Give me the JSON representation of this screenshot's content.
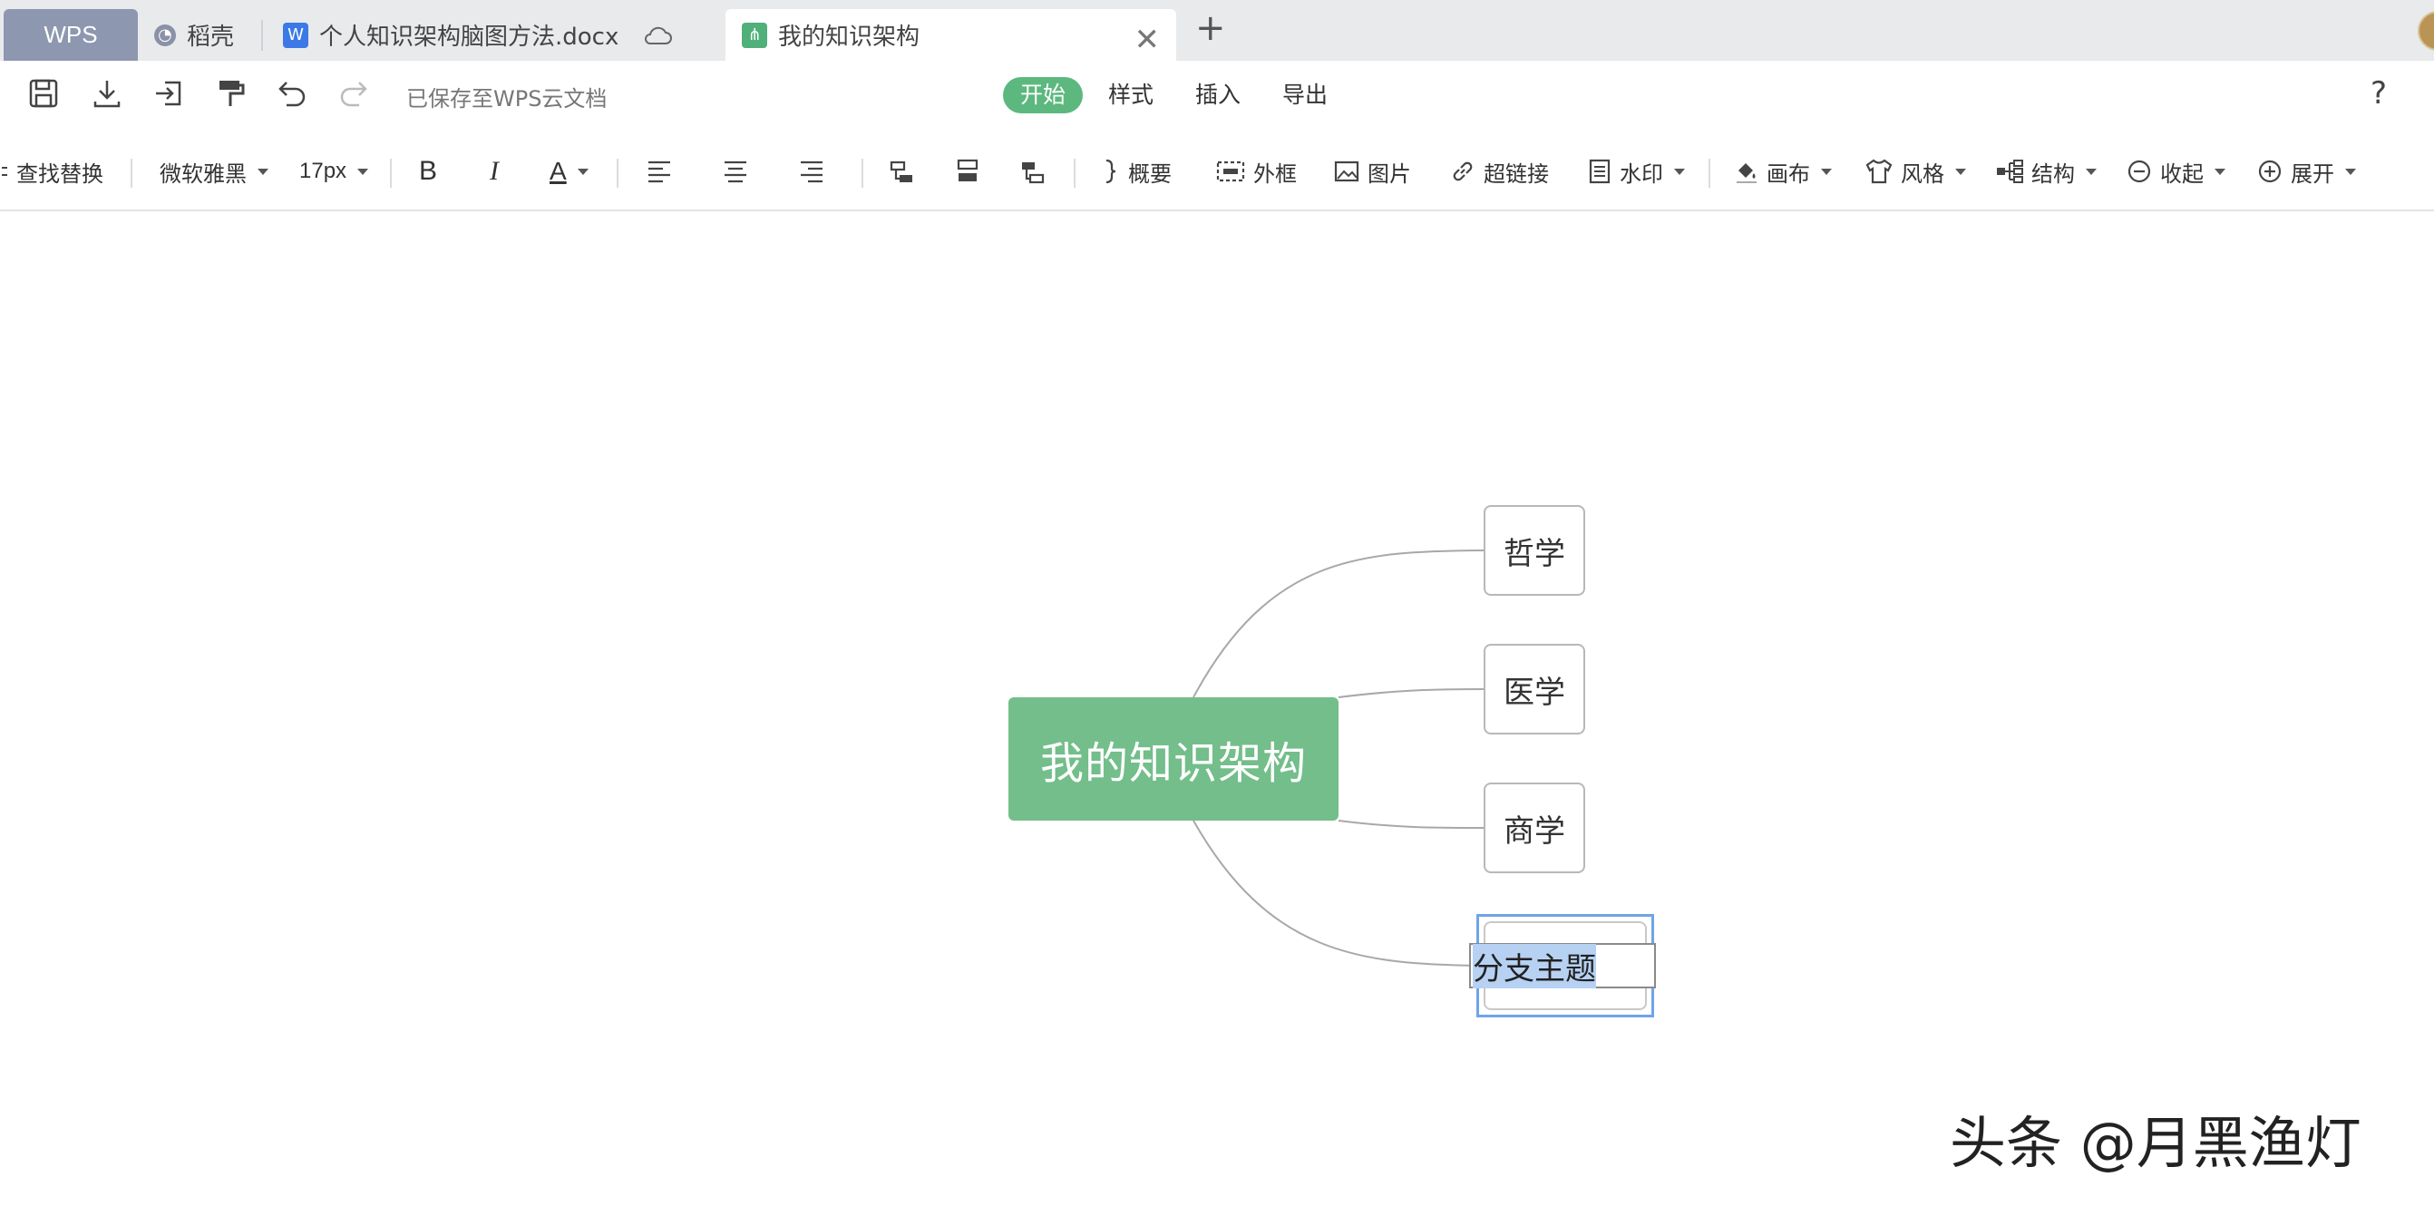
{
  "tabs": [
    {
      "label": "WPS"
    },
    {
      "label": "稻壳"
    },
    {
      "label": "个人知识架构脑图方法.docx"
    },
    {
      "label": "我的知识架构"
    }
  ],
  "toolbar1": {
    "saved_status": "已保存至WPS云文档",
    "menu_tabs": [
      "开始",
      "样式",
      "插入",
      "导出"
    ],
    "active_tab": "开始"
  },
  "toolbar2": {
    "find_replace": "查找替换",
    "font_family": "微软雅黑",
    "font_size": "17px",
    "bold": "B",
    "italic": "I",
    "font_color": "A",
    "summary": "概要",
    "outline": "外框",
    "image": "图片",
    "hyperlink": "超链接",
    "watermark": "水印",
    "canvas": "画布",
    "style": "风格",
    "structure": "结构",
    "collapse": "收起",
    "expand": "展开"
  },
  "mindmap": {
    "root": "我的知识架构",
    "branches": [
      "哲学",
      "医学",
      "商学"
    ],
    "editing_branch": "分支主题"
  },
  "colors": {
    "accent_green": "#5cb87e",
    "root_fill": "#73be8a",
    "selection_blue": "#6fa4e8"
  },
  "watermark_text": "头条 @月黑渔灯"
}
